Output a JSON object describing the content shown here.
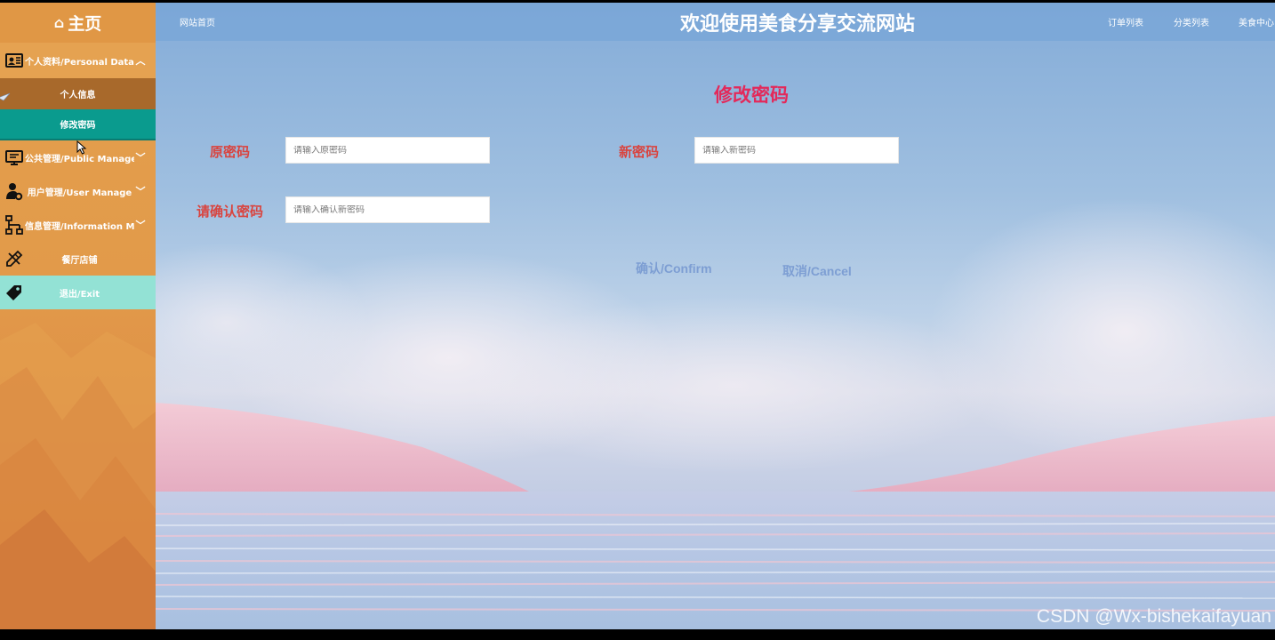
{
  "sidebar": {
    "home": {
      "icon": "home-icon",
      "label": "主页"
    },
    "groups": [
      {
        "icon": "profile-card-icon",
        "label": "个人资料/Personal Data",
        "chevron": "chevron-up-icon",
        "items": [
          {
            "label": "个人信息"
          },
          {
            "label": "修改密码",
            "active": true
          }
        ]
      },
      {
        "icon": "monitor-icon",
        "label": "公共管理/Public Manage",
        "chevron": "chevron-down-icon"
      },
      {
        "icon": "user-gear-icon",
        "label": "用户管理/User Manage",
        "chevron": "chevron-down-icon"
      },
      {
        "icon": "hierarchy-icon",
        "label": "信息管理/Information Manage",
        "chevron": "chevron-down-icon"
      },
      {
        "icon": "pencil-ruler-icon",
        "label": "餐厅店铺"
      },
      {
        "icon": "tag-icon",
        "label": "退出/Exit"
      }
    ]
  },
  "header": {
    "left_link": "网站首页",
    "title": "欢迎使用美食分享交流网站",
    "right_links": [
      "订单列表",
      "分类列表",
      "美食中心"
    ]
  },
  "form": {
    "title": "修改密码",
    "fields": [
      {
        "label": "原密码",
        "placeholder": "请输入原密码",
        "value": ""
      },
      {
        "label": "新密码",
        "placeholder": "请输入新密码",
        "value": ""
      },
      {
        "label": "请确认密码",
        "placeholder": "请输入确认新密码",
        "value": ""
      }
    ],
    "confirm_label": "确认/Confirm",
    "cancel_label": "取消/Cancel"
  },
  "watermark": "CSDN @Wx-bishekaifayuan",
  "colors": {
    "sidebar_orange": "#e29a4a",
    "active_teal": "#0a9b8e",
    "exit_mint": "#93e2d5",
    "title_pink": "#e3295a",
    "label_red": "#d9443f",
    "button_blue": "#7d9ed3"
  }
}
